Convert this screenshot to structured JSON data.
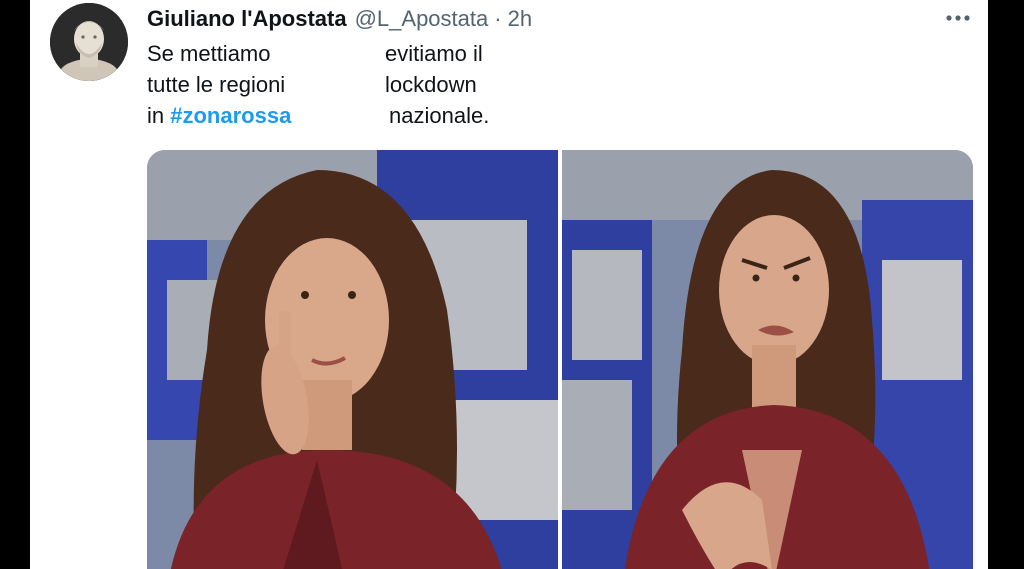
{
  "tweet": {
    "author_name": "Giuliano l'Apostata",
    "author_handle": "@L_Apostata",
    "separator": "·",
    "timestamp": "2h",
    "text_lines": [
      {
        "left": "Se mettiamo",
        "right": "evitiamo il"
      },
      {
        "left": "tutte le regioni",
        "right": "lockdown"
      },
      {
        "left_prefix": "in ",
        "hashtag": "#zonarossa",
        "right": "nazionale."
      }
    ],
    "hashtag_color": "#1d9bf0"
  },
  "icons": {
    "more": "more-horizontal-icon",
    "avatar": "bust-statue-avatar"
  },
  "media": {
    "photo_count": 2
  }
}
